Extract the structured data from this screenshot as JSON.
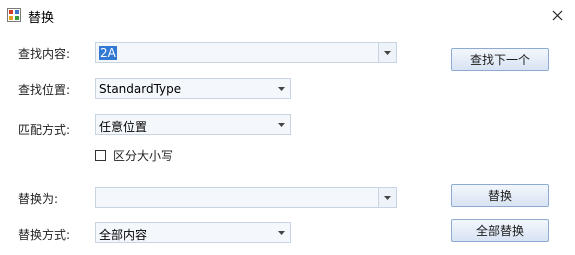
{
  "window": {
    "title": "替换"
  },
  "find": {
    "label": "查找内容:",
    "value": "2A"
  },
  "look_in": {
    "label": "查找位置:",
    "value": "StandardType"
  },
  "match": {
    "label": "匹配方式:",
    "value": "任意位置"
  },
  "case_sensitive": {
    "label": "区分大小写",
    "checked": false
  },
  "replace_with": {
    "label": "替换为:",
    "value": ""
  },
  "replace_mode": {
    "label": "替换方式:",
    "value": "全部内容"
  },
  "buttons": {
    "find_next": "查找下一个",
    "replace": "替换",
    "replace_all": "全部替换"
  },
  "icons": {
    "app": "app-icon",
    "close": "close-icon",
    "dropdown": "chevron-down-icon"
  }
}
